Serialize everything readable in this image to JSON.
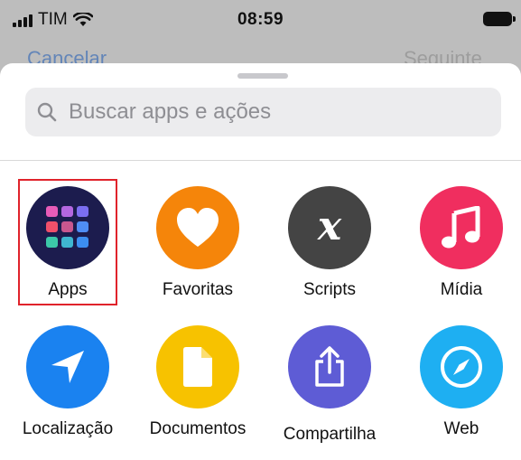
{
  "status_bar": {
    "carrier": "TIM",
    "time": "08:59"
  },
  "background": {
    "left_action": "Cancelar",
    "right_action": "Seguinte"
  },
  "search": {
    "placeholder": "Buscar apps e ações"
  },
  "categories": [
    {
      "label": "Apps",
      "icon": "apps-grid-icon",
      "color": "#1c1c4e",
      "selected": true
    },
    {
      "label": "Favoritas",
      "icon": "heart-icon",
      "color": "#f5850a"
    },
    {
      "label": "Scripts",
      "icon": "x-variable-icon",
      "color": "#444444"
    },
    {
      "label": "Mídia",
      "icon": "music-note-icon",
      "color": "#f02e5f"
    },
    {
      "label": "Localização",
      "icon": "location-arrow-icon",
      "color": "#1a82f0"
    },
    {
      "label": "Documentos",
      "icon": "document-icon",
      "color": "#f7c200"
    },
    {
      "label": "Compartilha",
      "icon": "share-icon",
      "color": "#5e5cd5"
    },
    {
      "label": "Web",
      "icon": "compass-icon",
      "color": "#1eaff2"
    }
  ]
}
